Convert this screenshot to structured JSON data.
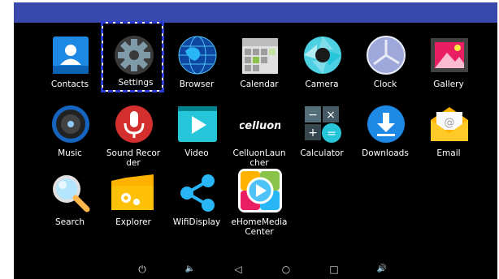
{
  "apps": [
    {
      "label": "Contacts",
      "icon": "contacts-icon"
    },
    {
      "label": "Settings",
      "icon": "settings-gear-icon",
      "selected": true
    },
    {
      "label": "Browser",
      "icon": "globe-icon"
    },
    {
      "label": "Calendar",
      "icon": "calendar-icon"
    },
    {
      "label": "Camera",
      "icon": "camera-aperture-icon"
    },
    {
      "label": "Clock",
      "icon": "clock-icon"
    },
    {
      "label": "Gallery",
      "icon": "gallery-photo-icon"
    },
    {
      "label": "Music",
      "icon": "speaker-icon"
    },
    {
      "label": "Sound Recorder",
      "icon": "microphone-icon"
    },
    {
      "label": "Video",
      "icon": "play-icon"
    },
    {
      "label": "CelluonLauncher",
      "icon": "celluon-logo-icon"
    },
    {
      "label": "Calculator",
      "icon": "calculator-icon"
    },
    {
      "label": "Downloads",
      "icon": "download-icon"
    },
    {
      "label": "Email",
      "icon": "envelope-icon"
    },
    {
      "label": "Search",
      "icon": "magnifier-icon"
    },
    {
      "label": "Explorer",
      "icon": "folder-icon"
    },
    {
      "label": "WifiDisplay",
      "icon": "share-icon"
    },
    {
      "label": "eHomeMedia Center",
      "icon": "media-play-icon"
    }
  ],
  "logo_text": {
    "celluon": "celluon"
  },
  "navbar": {
    "power": "⏻",
    "volume_down": "🔈",
    "back": "◁",
    "home": "○",
    "recents": "□",
    "volume_up": "🔊"
  },
  "colors": {
    "status_bar": "#3949ab",
    "background": "#000000",
    "selection": "#2a3bd8"
  }
}
